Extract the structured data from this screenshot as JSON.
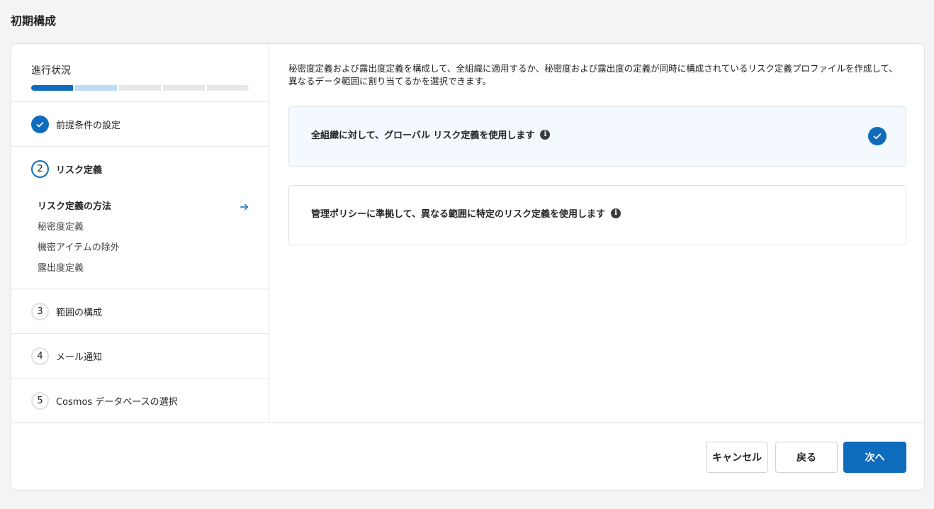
{
  "page": {
    "title": "初期構成"
  },
  "progress": {
    "label": "進行状況",
    "completed_fraction": 0.2,
    "current_fraction": 0.4
  },
  "steps": [
    {
      "number": "",
      "label": "前提条件の設定",
      "state": "done"
    },
    {
      "number": "2",
      "label": "リスク定義",
      "state": "current",
      "substeps": [
        {
          "label": "リスク定義の方法",
          "active": true
        },
        {
          "label": "秘密度定義",
          "active": false
        },
        {
          "label": "機密アイテムの除外",
          "active": false
        },
        {
          "label": "露出度定義",
          "active": false
        }
      ]
    },
    {
      "number": "3",
      "label": "範囲の構成",
      "state": "pending"
    },
    {
      "number": "4",
      "label": "メール通知",
      "state": "pending"
    },
    {
      "number": "5",
      "label": "Cosmos データベースの選択",
      "state": "pending"
    }
  ],
  "content": {
    "description": "秘密度定義および露出度定義を構成して、全組織に適用するか、秘密度および露出度の定義が同時に構成されているリスク定義プロファイルを作成して、異なるデータ範囲に割り当てるかを選択できます。",
    "options": [
      {
        "label": "全組織に対して、グローバル リスク定義を使用します",
        "selected": true
      },
      {
        "label": "管理ポリシーに準拠して、異なる範囲に特定のリスク定義を使用します",
        "selected": false
      }
    ]
  },
  "footer": {
    "cancel_label": "キャンセル",
    "back_label": "戻る",
    "next_label": "次へ"
  },
  "colors": {
    "accent": "#0f6cbd",
    "selected_bg": "#f3f9fe"
  },
  "icons": {
    "done": "check-icon",
    "info": "info-icon",
    "active_substep": "arrow-right-icon"
  }
}
